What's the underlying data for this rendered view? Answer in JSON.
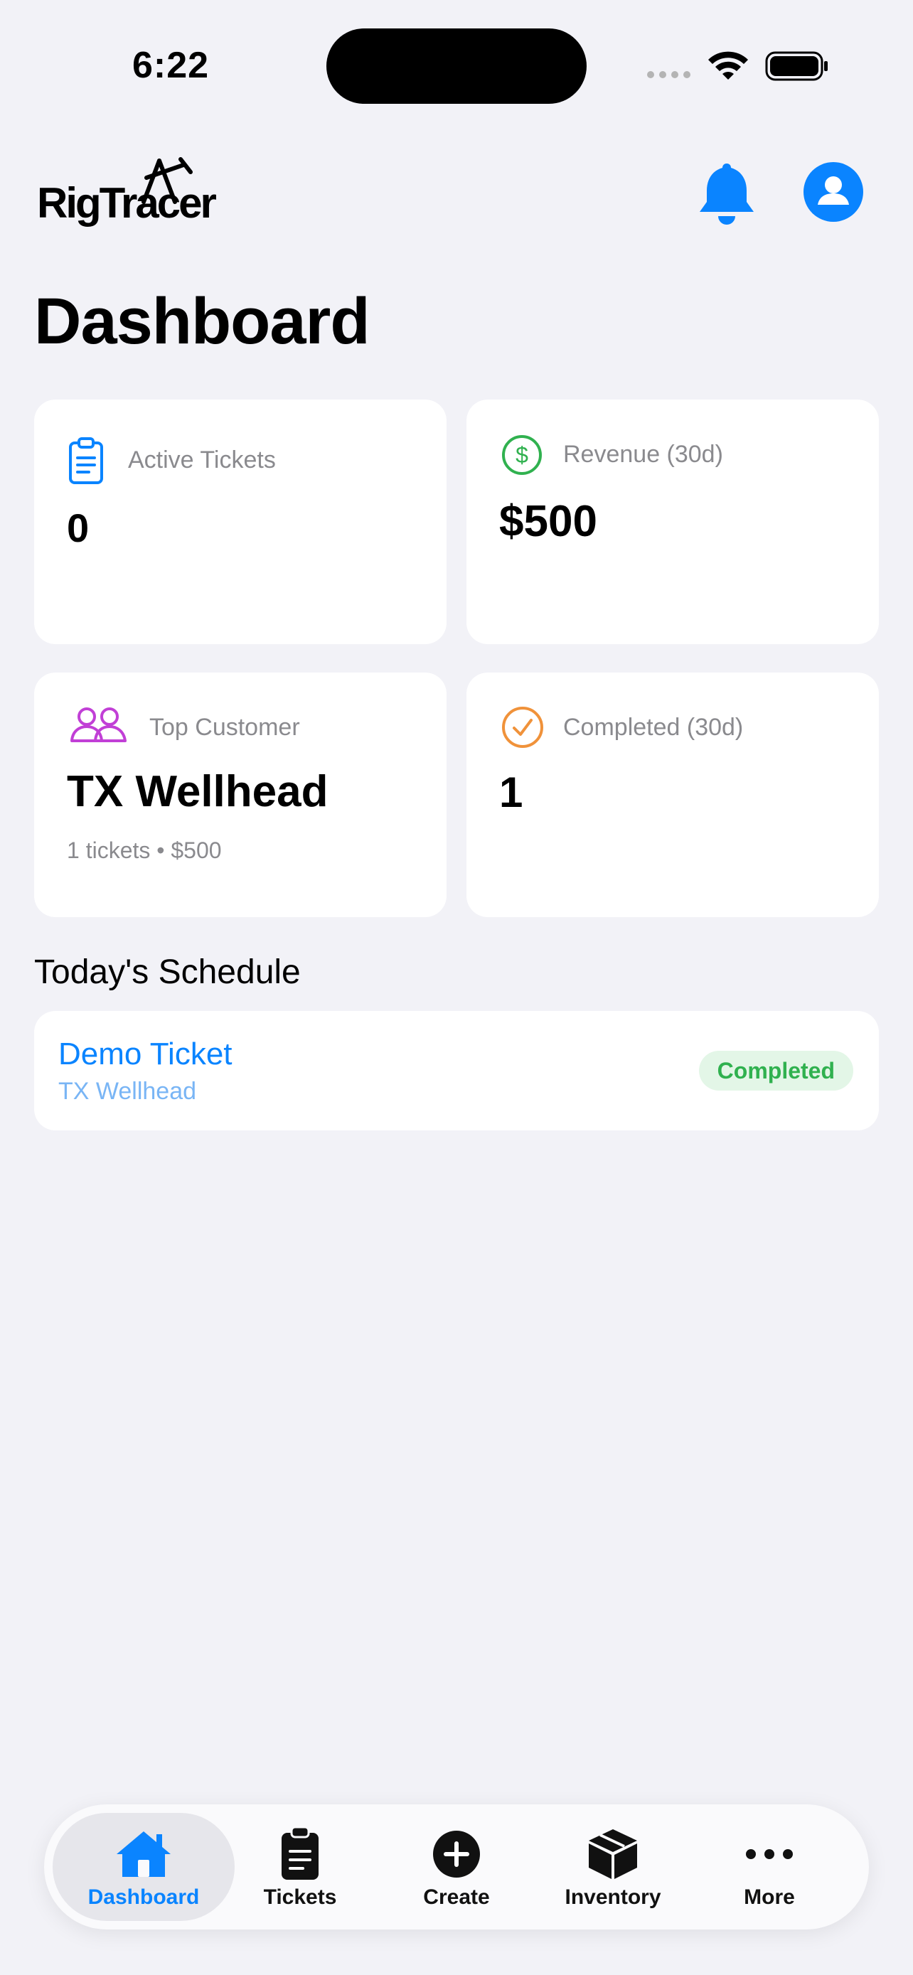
{
  "status_bar": {
    "time": "6:22"
  },
  "header": {
    "logo_text": "RigTracer"
  },
  "page_title": "Dashboard",
  "cards": {
    "active_tickets": {
      "label": "Active Tickets",
      "value": "0"
    },
    "revenue": {
      "label": "Revenue (30d)",
      "value": "$500"
    },
    "top_customer": {
      "label": "Top Customer",
      "value": "TX Wellhead",
      "sub": "1 tickets • $500"
    },
    "completed": {
      "label": "Completed (30d)",
      "value": "1"
    }
  },
  "schedule": {
    "title": "Today's Schedule",
    "items": [
      {
        "title": "Demo Ticket",
        "customer": "TX Wellhead",
        "status": "Completed"
      }
    ]
  },
  "tabbar": {
    "tabs": [
      {
        "label": "Dashboard",
        "icon": "house-icon",
        "active": true
      },
      {
        "label": "Tickets",
        "icon": "clipboard-icon",
        "active": false
      },
      {
        "label": "Create",
        "icon": "plus-circle-icon",
        "active": false
      },
      {
        "label": "Inventory",
        "icon": "box-icon",
        "active": false
      },
      {
        "label": "More",
        "icon": "ellipsis-icon",
        "active": false
      }
    ]
  },
  "colors": {
    "accent": "#0a84ff",
    "revenue_icon": "#30b14f",
    "customer_icon": "#c13fd6",
    "completed_icon": "#f0923a",
    "badge_bg": "#e3f6e7",
    "badge_text": "#30b14f"
  }
}
